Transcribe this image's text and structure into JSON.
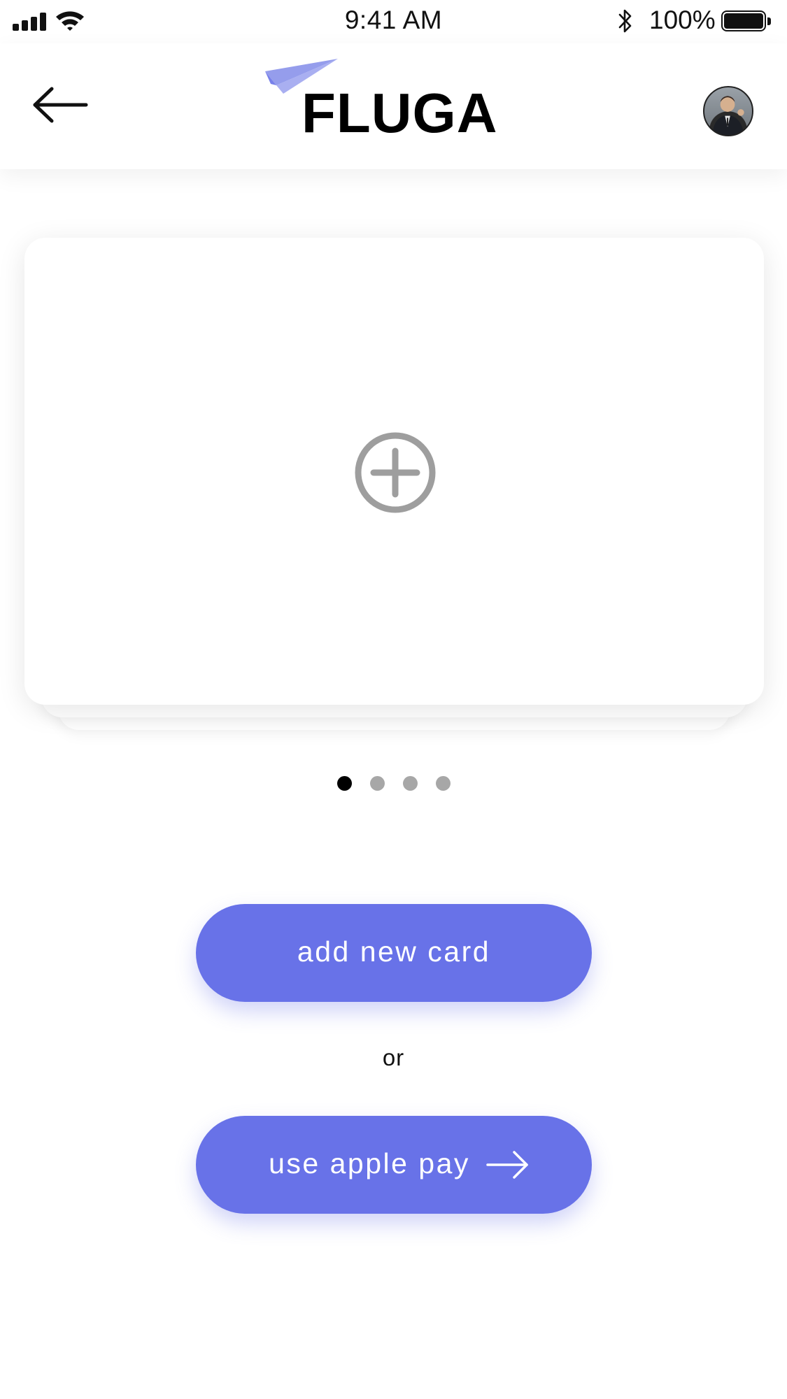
{
  "status_bar": {
    "time": "9:41 AM",
    "battery_percent": "100%",
    "battery_level": 1.0,
    "signal_bars": 4,
    "icons": [
      "signal-icon",
      "wifi-icon",
      "bluetooth-icon",
      "battery-icon"
    ]
  },
  "header": {
    "app_name": "FLUGA",
    "logo_icon": "paper-plane-icon",
    "back_icon": "arrow-left-icon",
    "avatar_icon": "user-avatar"
  },
  "card_carousel": {
    "add_icon": "plus-circle-icon",
    "page_count": 4,
    "active_index": 0
  },
  "actions": {
    "add_card_label": "add new card",
    "separator_label": "or",
    "apple_pay_label": "use apple pay",
    "apple_pay_icon": "arrow-right-icon"
  },
  "colors": {
    "accent": "#6872e8",
    "plane": "#8a92ea",
    "dot_active": "#000000",
    "dot_inactive": "#a7a7a7",
    "add_icon": "#9e9e9e"
  }
}
